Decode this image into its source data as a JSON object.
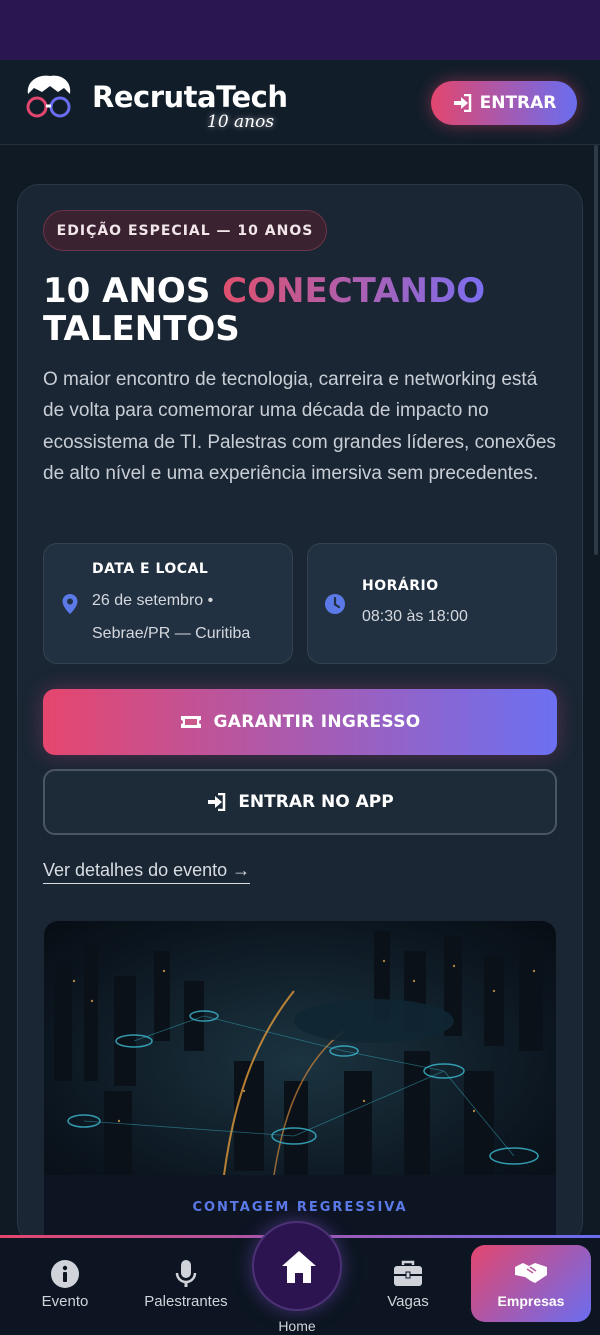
{
  "colors": {
    "accent_pink": "#e3466e",
    "accent_violet": "#6a6df0",
    "info_icon": "#5b7ae8",
    "background": "#0f1a24"
  },
  "header": {
    "brand": "RecrutaTech",
    "brand_sub": "10 anos",
    "logo_icon": "glasses-mascot-icon",
    "enter_button": {
      "label": "ENTRAR",
      "icon": "sign-in-icon"
    }
  },
  "hero": {
    "badge": "EDIÇÃO ESPECIAL — 10 ANOS",
    "title_part1": "10 ANOS ",
    "title_highlight": "CONECTANDO",
    "title_part2": "TALENTOS",
    "description": "O maior encontro de tecnologia, carreira e networking está de volta para comemorar uma década de impacto no ecossistema de TI. Palestras com grandes líderes, conexões de alto nível e uma experiência imersiva sem precedentes."
  },
  "info_cards": [
    {
      "label": "DATA E LOCAL",
      "value": "26 de setembro • Sebrae/PR — Curitiba",
      "icon": "map-pin-icon"
    },
    {
      "label": "HORÁRIO",
      "value": "08:30 às 18:00",
      "icon": "clock-icon"
    }
  ],
  "actions": {
    "primary": {
      "label": "GARANTIR INGRESSO",
      "icon": "ticket-icon"
    },
    "secondary": {
      "label": "ENTRAR NO APP",
      "icon": "sign-in-icon"
    },
    "details_link": "Ver detalhes do evento →"
  },
  "countdown": {
    "label": "CONTAGEM REGRESSIVA"
  },
  "bottom_nav": {
    "items": [
      {
        "label": "Evento",
        "icon": "info-circle-icon"
      },
      {
        "label": "Palestrantes",
        "icon": "microphone-icon"
      },
      {
        "label": "Home",
        "icon": "home-icon"
      },
      {
        "label": "Vagas",
        "icon": "briefcase-icon"
      },
      {
        "label": "Empresas",
        "icon": "handshake-icon"
      }
    ],
    "active": "Empresas"
  }
}
